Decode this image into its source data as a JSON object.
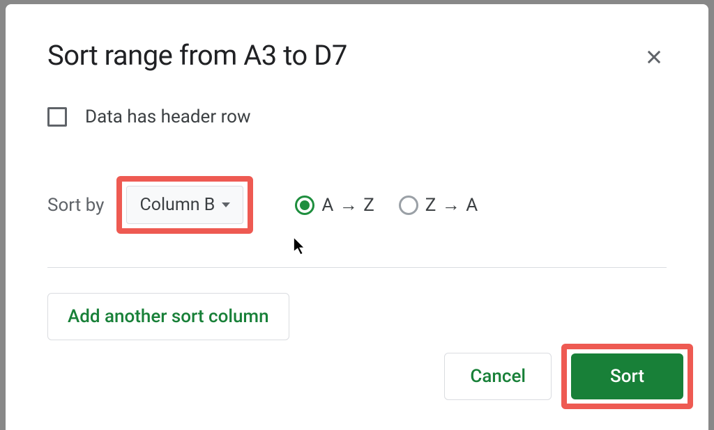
{
  "dialog": {
    "title": "Sort range from A3 to D7",
    "header_checkbox_label": "Data has header row",
    "sort_by_label": "Sort by",
    "column_dropdown": "Column B",
    "radio_az": "A → Z",
    "radio_za": "Z → A",
    "add_column": "Add another sort column",
    "cancel": "Cancel",
    "sort": "Sort"
  }
}
